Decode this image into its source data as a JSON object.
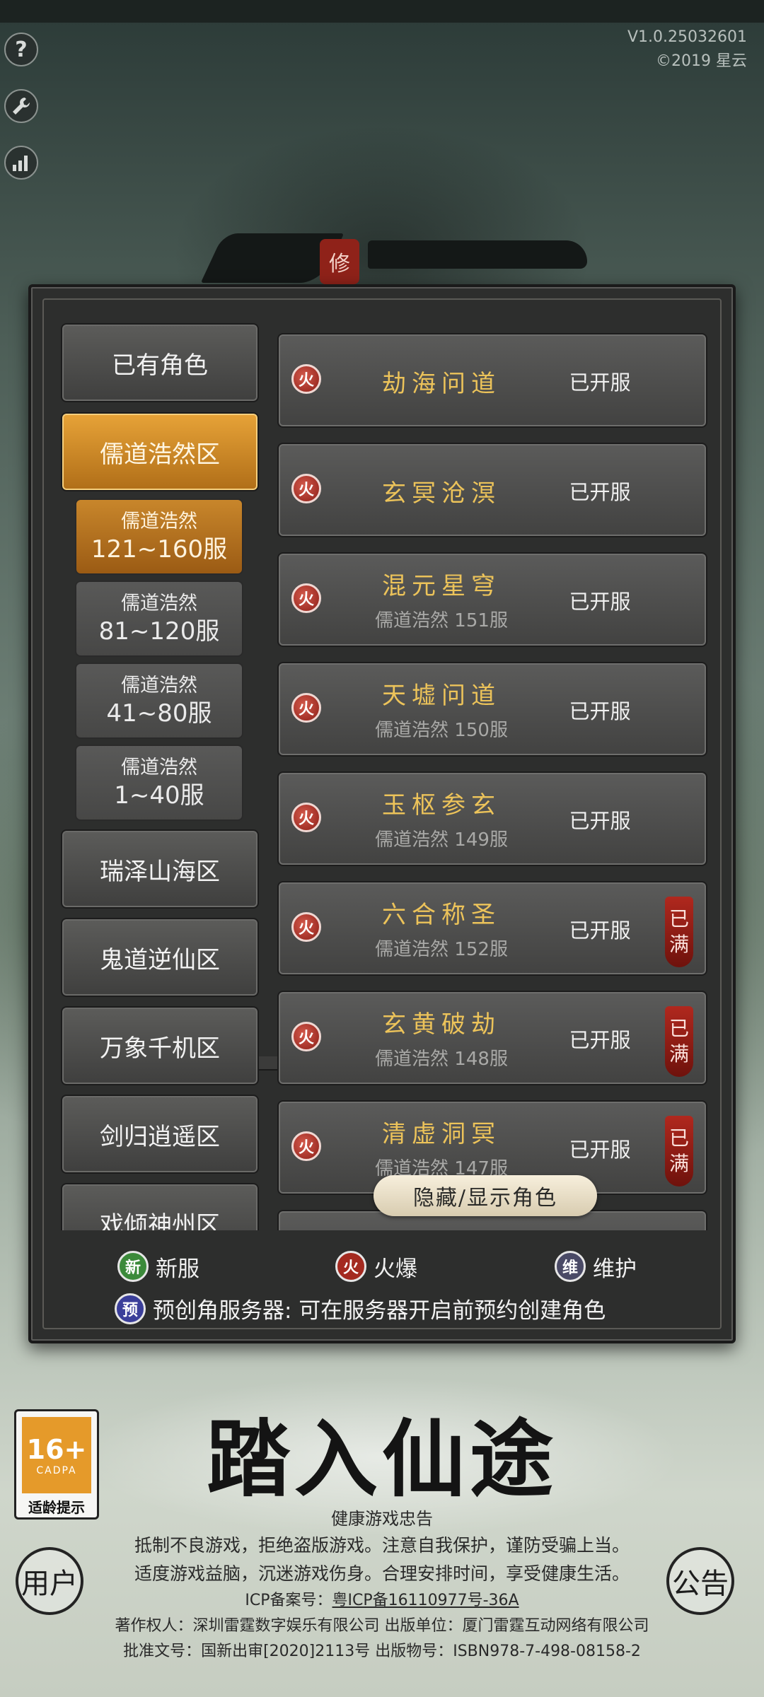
{
  "app": {
    "version": "V1.0.25032601",
    "copyright": "©2019 星云",
    "seal_char": "修"
  },
  "side_buttons": [
    {
      "icon": "help-icon",
      "glyph": "?"
    },
    {
      "icon": "wrench-icon",
      "glyph": "🔧"
    },
    {
      "icon": "signal-icon",
      "glyph": "▂▄▆"
    }
  ],
  "categories": [
    {
      "label": "已有角色",
      "active": false
    },
    {
      "label": "儒道浩然区",
      "active": true
    },
    {
      "label": "瑞泽山海区",
      "active": false
    },
    {
      "label": "鬼道逆仙区",
      "active": false
    },
    {
      "label": "万象千机区",
      "active": false
    },
    {
      "label": "剑归逍遥区",
      "active": false
    },
    {
      "label": "戏倾神州区",
      "active": false
    }
  ],
  "subcategories": [
    {
      "line1": "儒道浩然",
      "line2": "121~160服",
      "active": true
    },
    {
      "line1": "儒道浩然",
      "line2": "81~120服",
      "active": false
    },
    {
      "line1": "儒道浩然",
      "line2": "41~80服",
      "active": false
    },
    {
      "line1": "儒道浩然",
      "line2": "1~40服",
      "active": false
    }
  ],
  "servers": [
    {
      "badge": "火",
      "name": "劫海问道",
      "sub": "",
      "status": "已开服",
      "full": false
    },
    {
      "badge": "火",
      "name": "玄冥沧溟",
      "sub": "",
      "status": "已开服",
      "full": false
    },
    {
      "badge": "火",
      "name": "混元星穹",
      "sub": "儒道浩然 151服",
      "status": "已开服",
      "full": false
    },
    {
      "badge": "火",
      "name": "天墟问道",
      "sub": "儒道浩然 150服",
      "status": "已开服",
      "full": false
    },
    {
      "badge": "火",
      "name": "玉枢参玄",
      "sub": "儒道浩然 149服",
      "status": "已开服",
      "full": false
    },
    {
      "badge": "火",
      "name": "六合称圣",
      "sub": "儒道浩然 152服",
      "status": "已开服",
      "full": true
    },
    {
      "badge": "火",
      "name": "玄黄破劫",
      "sub": "儒道浩然 148服",
      "status": "已开服",
      "full": true
    },
    {
      "badge": "火",
      "name": "清虚洞冥",
      "sub": "儒道浩然 147服",
      "status": "已开服",
      "full": true
    }
  ],
  "full_tag": {
    "c1": "已",
    "c2": "满"
  },
  "toggle_label": "隐藏/显示角色",
  "legend": {
    "new": {
      "glyph": "新",
      "label": "新服",
      "color": "#3b8a3a"
    },
    "hot": {
      "glyph": "火",
      "label": "火爆",
      "color": "#a42a20"
    },
    "maint": {
      "glyph": "维",
      "label": "维护",
      "color": "#4a4a66"
    },
    "pre": {
      "glyph": "预",
      "label": "预创角服务器: 可在服务器开启前预约创建角色",
      "color": "#3b3f9a"
    }
  },
  "age_rating": {
    "num": "16+",
    "org": "CADPA",
    "label": "适龄提示"
  },
  "game_title": "踏入仙途",
  "notice": {
    "heading": "健康游戏忠告",
    "line1": "抵制不良游戏，拒绝盗版游戏。注意自我保护，谨防受骗上当。",
    "line2": "适度游戏益脑，沉迷游戏伤身。合理安排时间，享受健康生活。",
    "icp_label": "ICP备案号：",
    "icp_value": "粤ICP备16110977号-36A",
    "line4": "著作权人：深圳雷霆数字娱乐有限公司 出版单位：厦门雷霆互动网络有限公司",
    "line5": "批准文号：国新出审[2020]2113号 出版物号：ISBN978-7-498-08158-2"
  },
  "stamps": {
    "left": "用户",
    "right": "公告"
  }
}
